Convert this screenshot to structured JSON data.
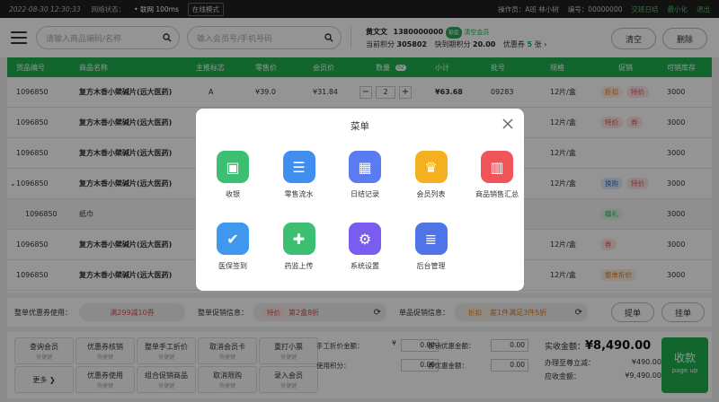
{
  "topbar": {
    "datetime": "2022-08-30 12:30:33",
    "network_label": "网络状态：",
    "network_value": "• 联网 100ms",
    "mode": "在线模式",
    "operator": "操作员：A班 林小树",
    "code": "编号：00000000",
    "shift_button": "交班日结",
    "minimize_button": "最小化",
    "exit_button": "退出"
  },
  "header": {
    "product_search_placeholder": "请输入商品编码/名称",
    "member_search_placeholder": "输入会员号/手机号码",
    "member_name": "黄文文",
    "member_phone": "1380000000",
    "member_level": "铂金",
    "member_clear": "清空会员",
    "points_label": "当前积分",
    "points_value": "305802",
    "expiring_label": "快到期积分",
    "expiring_value": "20.00",
    "coupon_label": "优惠券",
    "coupon_value": "5",
    "coupon_unit": "张",
    "clear_button": "清空",
    "delete_button": "删除"
  },
  "table": {
    "headers": [
      "货品编号",
      "商品名称",
      "主推标志",
      "零售价",
      "会员价",
      "数量",
      "小计",
      "批号",
      "规格",
      "促销",
      "可销库存"
    ],
    "qty_badge": "02",
    "rows": [
      {
        "id": "1096850",
        "name": "复方木香小檗碱片(远大医药)",
        "flag": "A",
        "price": "¥39.0",
        "member_price": "¥31.84",
        "qty": "2",
        "subtotal": "¥63.68",
        "batch": "09283",
        "spec": "12片/盒",
        "promos": [
          "折扣",
          "特价"
        ],
        "stock": "3000"
      },
      {
        "id": "1096850",
        "name": "复方木香小檗碱片(远大医药)",
        "flag": "",
        "price": "",
        "member_price": "",
        "qty": "",
        "subtotal": "",
        "batch": "",
        "spec": "12片/盒",
        "promos": [
          "特价",
          "券"
        ],
        "stock": "3000"
      },
      {
        "id": "1096850",
        "name": "复方木香小檗碱片(远大医药)",
        "flag": "",
        "price": "",
        "member_price": "",
        "qty": "",
        "subtotal": "",
        "batch": "",
        "spec": "12片/盒",
        "promos": [],
        "stock": "3000"
      },
      {
        "id": "1096850",
        "name": "复方木香小檗碱片(远大医药)",
        "flag": "",
        "price": "",
        "member_price": "",
        "qty": "",
        "subtotal": "",
        "batch": "",
        "spec": "12片/盒",
        "promos": [
          "换购",
          "特价"
        ],
        "stock": "3000"
      },
      {
        "id": "1096850",
        "name": "纸巾",
        "flag": "",
        "price": "",
        "member_price": "",
        "qty": "",
        "subtotal": "",
        "batch": "",
        "spec": "",
        "promos": [
          "赠礼"
        ],
        "stock": "3000"
      },
      {
        "id": "1096850",
        "name": "复方木香小檗碱片(远大医药)",
        "flag": "",
        "price": "",
        "member_price": "",
        "qty": "",
        "subtotal": "",
        "batch": "",
        "spec": "12片/盒",
        "promos": [
          "券"
        ],
        "stock": "3000"
      },
      {
        "id": "1096850",
        "name": "复方木香小檗碱片(远大医药)",
        "flag": "",
        "price": "",
        "member_price": "",
        "qty": "",
        "subtotal": "",
        "batch": "",
        "spec": "12片/盒",
        "promos": [
          "整单折价"
        ],
        "stock": "3000"
      }
    ]
  },
  "promo_bar": {
    "coupon_label": "整单优惠券使用：",
    "coupon_value": "满299减10券",
    "order_promo_label": "整单促销信息：",
    "order_promo_tag": "特价",
    "order_promo_value": "第2盒8折",
    "item_promo_label": "单品促销信息：",
    "item_promo_tag": "折扣",
    "item_promo_value": "差1件满足3件5折",
    "hold_button": "挂单",
    "pick_button": "提单"
  },
  "shortcuts": [
    {
      "label": "查询会员",
      "hint": "快捷键"
    },
    {
      "label": "优惠券核销",
      "hint": "快捷键"
    },
    {
      "label": "整单手工折价",
      "hint": "快捷键"
    },
    {
      "label": "取消会员卡",
      "hint": "快捷键"
    },
    {
      "label": "重打小票",
      "hint": "快捷键"
    },
    {
      "label": "更多 ❯",
      "hint": ""
    },
    {
      "label": "优惠券使用",
      "hint": "快捷键"
    },
    {
      "label": "组合促销商品",
      "hint": "快捷键"
    },
    {
      "label": "取消限购",
      "hint": "快捷键"
    },
    {
      "label": "录入会员",
      "hint": "快捷键"
    }
  ],
  "amounts": {
    "manual_discount_label": "手工折价金额：",
    "manual_discount_value": "0.00",
    "promo_discount_label": "促销优惠金额：",
    "promo_discount_value": "0.00",
    "points_used_label": "使用积分：",
    "points_used_value": "0.00",
    "coupon_discount_label": "券优惠金额：",
    "coupon_discount_value": "0.00",
    "currency": "¥",
    "paid_label": "实收金额：",
    "paid_value": "¥8,490.00",
    "reduction_label": "办理至尊立减：",
    "reduction_value": "¥490.00",
    "receivable_label": "应收金额：",
    "receivable_value": "¥9,490.00",
    "checkout_label": "收款",
    "checkout_hint": "page up"
  },
  "modal": {
    "title": "菜单",
    "items": [
      {
        "label": "收银",
        "icon": "cash-register-icon",
        "color": "#3dbf72"
      },
      {
        "label": "零售流水",
        "icon": "document-list-icon",
        "color": "#3f8ef0"
      },
      {
        "label": "日结记录",
        "icon": "calendar-icon",
        "color": "#5a7cf0"
      },
      {
        "label": "会员列表",
        "icon": "crown-icon",
        "color": "#f5b01f"
      },
      {
        "label": "商品销售汇总",
        "icon": "monitor-chart-icon",
        "color": "#f0555a"
      },
      {
        "label": "医保签到",
        "icon": "check-card-icon",
        "color": "#3f98ee"
      },
      {
        "label": "药监上传",
        "icon": "shield-plus-icon",
        "color": "#3dbf72"
      },
      {
        "label": "系统设置",
        "icon": "gear-icon",
        "color": "#7a5cf0"
      },
      {
        "label": "后台管理",
        "icon": "server-icon",
        "color": "#4f74e8"
      }
    ]
  }
}
